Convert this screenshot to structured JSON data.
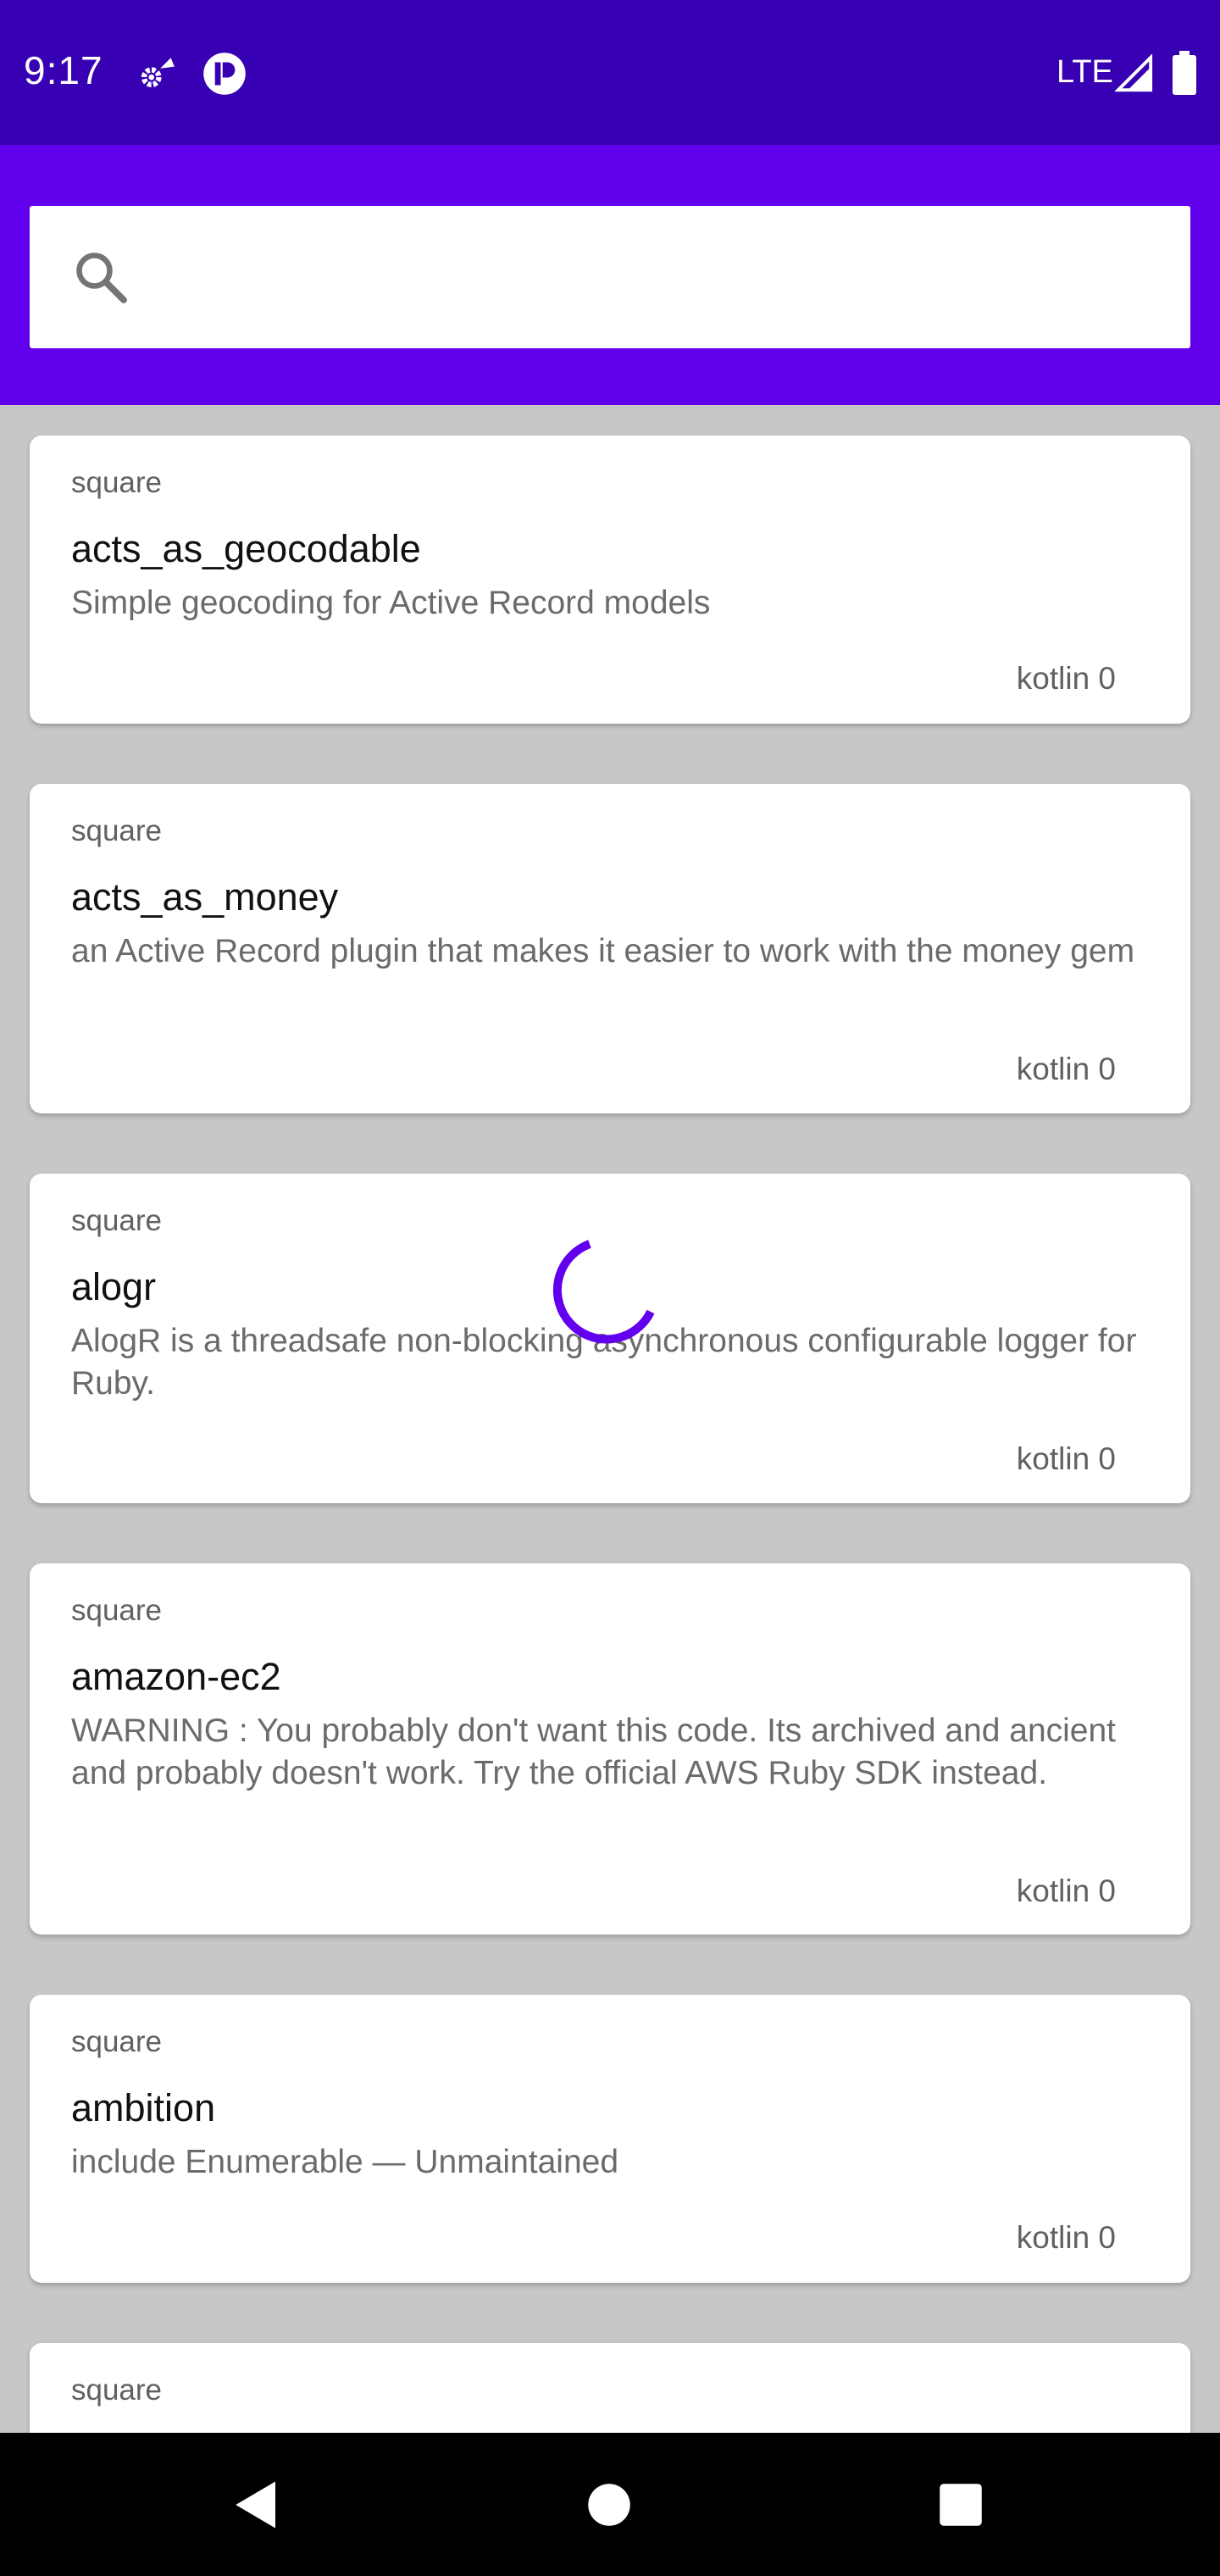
{
  "status_bar": {
    "time": "9:17",
    "network": "LTE"
  },
  "search": {
    "placeholder": "",
    "value": ""
  },
  "repos": [
    {
      "owner": "square",
      "name": "acts_as_geocodable",
      "description": "Simple geocoding for Active Record models",
      "stats": "kotlin 0"
    },
    {
      "owner": "square",
      "name": "acts_as_money",
      "description": "an Active Record plugin that makes it easier to work with the money gem",
      "stats": "kotlin 0"
    },
    {
      "owner": "square",
      "name": "alogr",
      "description": "AlogR is a threadsafe non-blocking asynchronous configurable logger for Ruby.",
      "stats": "kotlin 0"
    },
    {
      "owner": "square",
      "name": "amazon-ec2",
      "description": "WARNING : You probably don't want this code. Its archived and ancient and probably doesn't work. Try the official AWS Ruby SDK instead.",
      "stats": "kotlin 0"
    },
    {
      "owner": "square",
      "name": "ambition",
      "description": "include Enumerable — Unmaintained",
      "stats": "kotlin 0"
    },
    {
      "owner": "square"
    }
  ],
  "colors": {
    "status_bar": "#3800b3",
    "app_bar": "#6200ee",
    "accent": "#6200ee",
    "background": "#c7c7c7"
  },
  "icons": {
    "search": "search-icon",
    "status": [
      "gear-notification-icon",
      "p-notification-icon",
      "signal-icon",
      "battery-icon"
    ],
    "nav": [
      "back-icon",
      "home-icon",
      "recents-icon"
    ],
    "loading": "loading-spinner"
  }
}
